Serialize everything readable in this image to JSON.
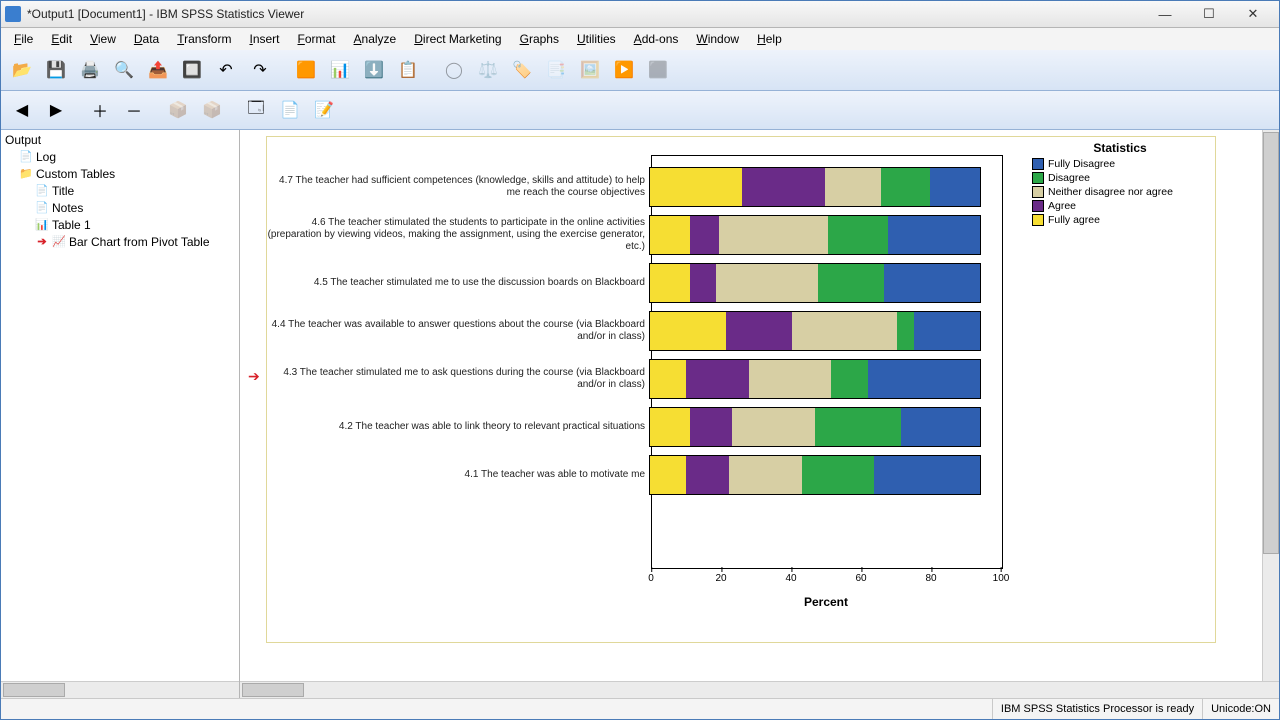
{
  "title": "*Output1 [Document1] - IBM SPSS Statistics Viewer",
  "menu": [
    "File",
    "Edit",
    "View",
    "Data",
    "Transform",
    "Insert",
    "Format",
    "Analyze",
    "Direct Marketing",
    "Graphs",
    "Utilities",
    "Add-ons",
    "Window",
    "Help"
  ],
  "outline": {
    "root": "Output",
    "items": [
      "Log",
      "Custom Tables",
      "Title",
      "Notes",
      "Table 1",
      "Bar Chart from Pivot Table"
    ]
  },
  "legend": {
    "title": "Statistics",
    "items": [
      "Fully Disagree",
      "Disagree",
      "Neither disagree nor agree",
      "Agree",
      "Fully agree"
    ]
  },
  "xlabel": "Percent",
  "xticks": [
    "0",
    "20",
    "40",
    "60",
    "80",
    "100"
  ],
  "status": {
    "processor": "IBM SPSS Statistics Processor is ready",
    "unicode": "Unicode:ON"
  },
  "chart_data": {
    "type": "bar",
    "orientation": "horizontal-stacked",
    "xlabel": "Percent",
    "xlim": [
      0,
      100
    ],
    "legend_title": "Statistics",
    "series_names": [
      "Fully Disagree",
      "Disagree",
      "Neither disagree nor agree",
      "Agree",
      "Fully agree"
    ],
    "categories": [
      "4.7 The teacher had sufficient competences (knowledge, skills and attitude) to help me reach the course objectives",
      "4.6 The teacher stimulated the students to participate in the online activities (preparation by viewing videos, making the assignment, using the exercise generator, etc.)",
      "4.5 The teacher stimulated me to use the discussion boards on Blackboard",
      "4.4 The teacher was available to answer questions about the course (via Blackboard and/or in class)",
      "4.3 The teacher stimulated me to ask questions during the course (via Blackboard and/or in class)",
      "4.2 The teacher was able to link theory to relevant practical situations",
      "4.1 The teacher was able to motivate me"
    ],
    "values": [
      [
        28,
        25,
        17,
        15,
        15
      ],
      [
        12,
        9,
        33,
        18,
        28
      ],
      [
        12,
        8,
        31,
        20,
        29
      ],
      [
        23,
        20,
        32,
        5,
        20
      ],
      [
        11,
        19,
        25,
        11,
        34
      ],
      [
        12,
        13,
        25,
        26,
        24
      ],
      [
        11,
        13,
        22,
        22,
        32
      ]
    ],
    "colors": {
      "Fully Disagree": "#f6de33",
      "Disagree": "#6a2b88",
      "Neither disagree nor agree": "#d7cfa4",
      "Agree": "#2ca748",
      "Fully agree": "#2f5fb0"
    }
  }
}
